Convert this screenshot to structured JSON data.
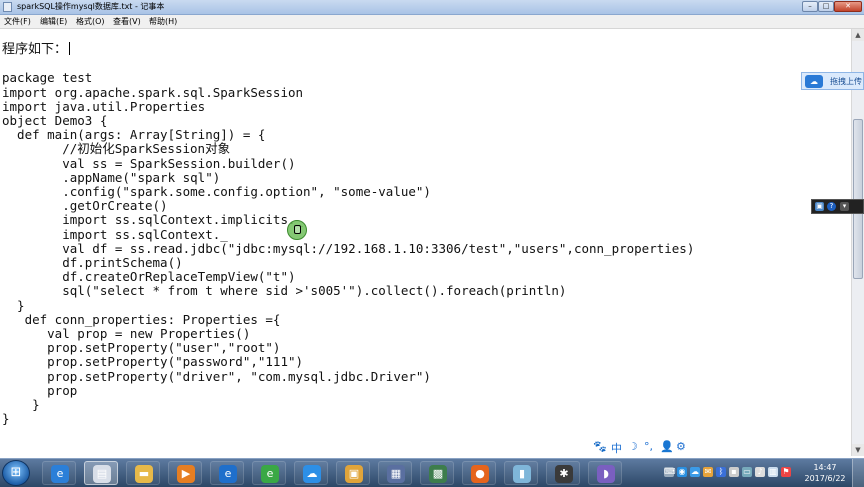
{
  "window": {
    "title": "sparkSQL操作mysql数据库.txt - 记事本",
    "minimize": "–",
    "maximize": "□",
    "close": "✕"
  },
  "menu": [
    "文件(F)",
    "编辑(E)",
    "格式(O)",
    "查看(V)",
    "帮助(H)"
  ],
  "editor": {
    "lines": [
      "程序如下：",
      "",
      "package test",
      "import org.apache.spark.sql.SparkSession",
      "import java.util.Properties",
      "object Demo3 {",
      "  def main(args: Array[String]) = {",
      "        //初始化SparkSession对象",
      "        val ss = SparkSession.builder()",
      "        .appName(\"spark sql\")",
      "        .config(\"spark.some.config.option\", \"some-value\")",
      "        .getOrCreate()",
      "        import ss.sqlContext.implicits._",
      "        import ss.sqlContext._",
      "        val df = ss.read.jdbc(\"jdbc:mysql://192.168.1.10:3306/test\",\"users\",conn_properties)",
      "        df.printSchema()",
      "        df.createOrReplaceTempView(\"t\")",
      "        sql(\"select * from t where sid >'s005'\").collect().foreach(println)",
      "  }",
      "   def conn_properties: Properties ={",
      "      val prop = new Properties()",
      "      prop.setProperty(\"user\",\"root\")",
      "      prop.setProperty(\"password\",\"111\")",
      "      prop.setProperty(\"driver\", \"com.mysql.jdbc.Driver\")",
      "      prop",
      "    }",
      "}"
    ]
  },
  "overlay": {
    "upload_label": "拖拽上传"
  },
  "ime": {
    "items": [
      "🐾",
      "中",
      "☽",
      "°,",
      "👤",
      "⚙"
    ]
  },
  "taskbar": {
    "start_icon": "windows-logo-icon",
    "apps": [
      {
        "icon": "ie-icon",
        "glyph": "e",
        "color": "#2b7fd8"
      },
      {
        "icon": "notepad-icon",
        "glyph": "▤",
        "color": "#d8dee8"
      },
      {
        "icon": "folder-icon",
        "glyph": "▬",
        "color": "#e7b949"
      },
      {
        "icon": "media-player-icon",
        "glyph": "▶",
        "color": "#e67e22"
      },
      {
        "icon": "ie-alt-icon",
        "glyph": "e",
        "color": "#1f6fcb"
      },
      {
        "icon": "360-browser-icon",
        "glyph": "e",
        "color": "#3aa845"
      },
      {
        "icon": "baidu-cloud-icon",
        "glyph": "☁",
        "color": "#2d8fe6"
      },
      {
        "icon": "explorer-icon",
        "glyph": "▣",
        "color": "#e0a43a"
      },
      {
        "icon": "remote-desktop-icon",
        "glyph": "▦",
        "color": "#5a6fa0"
      },
      {
        "icon": "security-icon",
        "glyph": "▩",
        "color": "#3d7d4c"
      },
      {
        "icon": "firefox-icon",
        "glyph": "●",
        "color": "#e5641c"
      },
      {
        "icon": "mobile-icon",
        "glyph": "▮",
        "color": "#7fb6d9"
      },
      {
        "icon": "capture-icon",
        "glyph": "✱",
        "color": "#3a3a3a"
      },
      {
        "icon": "eclipse-icon",
        "glyph": "◗",
        "color": "#7a5fc0"
      }
    ],
    "tray_icons": [
      "tray-keyboard-icon",
      "tray-qq-icon",
      "tray-cloud-icon",
      "tray-mail-icon",
      "tray-bluetooth-icon",
      "tray-lock-icon",
      "tray-monitor-icon",
      "tray-volume-icon",
      "tray-network-icon",
      "tray-flag-icon"
    ],
    "clock_time": "14:47",
    "clock_date": "2017/6/22"
  }
}
